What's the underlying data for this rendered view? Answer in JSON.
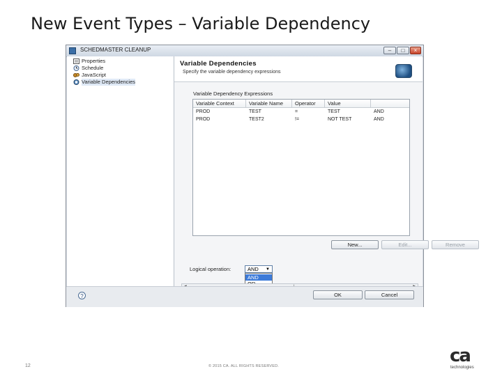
{
  "slide": {
    "title": "New Event Types – Variable Dependency",
    "page_number": "12",
    "copyright": "© 2015 CA. ALL RIGHTS RESERVED.",
    "logo": {
      "mark": "ca",
      "text": "technologies"
    }
  },
  "window": {
    "title": "SCHEDMASTER CLEANUP",
    "controls": {
      "minimize": "–",
      "maximize": "□",
      "close": "×"
    }
  },
  "tree": {
    "items": [
      {
        "label": "Properties",
        "icon": "properties-icon"
      },
      {
        "label": "Schedule",
        "icon": "schedule-icon"
      },
      {
        "label": "JavaScript",
        "icon": "javascript-icon"
      },
      {
        "label": "Variable Dependencies",
        "icon": "variable-dependencies-icon",
        "selected": true
      }
    ]
  },
  "panel": {
    "title": "Variable Dependencies",
    "subtitle": "Specify the variable dependency expressions",
    "group_label": "Variable Dependency Expressions",
    "columns": [
      "Variable Context",
      "Variable Name",
      "Operator",
      "Value",
      ""
    ],
    "rows": [
      [
        "PROD",
        "TEST",
        "=",
        "TEST",
        "AND"
      ],
      [
        "PROD",
        "TEST2",
        "!=",
        "NOT TEST",
        "AND"
      ]
    ],
    "buttons": {
      "new": "New...",
      "edit": "Edit...",
      "remove": "Remove"
    },
    "logical_operation_label": "Logical operation:",
    "logical_operation_value": "AND",
    "logical_operation_options": [
      "AND",
      "OR"
    ]
  },
  "footer": {
    "help": "?",
    "ok": "OK",
    "cancel": "Cancel"
  },
  "colors": {
    "selection": "#3d7bd9",
    "window_bg": "#d6dbe3"
  }
}
